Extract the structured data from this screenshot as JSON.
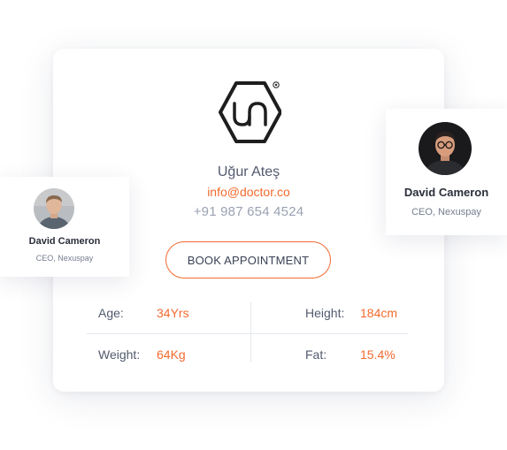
{
  "doctor": {
    "name": "Uğur Ateş",
    "email": "info@doctor.co",
    "phone": "+91 987 654 4524",
    "book_label": "BOOK APPOINTMENT",
    "logo_icon": "ua-hexagon-logo"
  },
  "stats": {
    "age": {
      "label": "Age:",
      "value": "34Yrs"
    },
    "height": {
      "label": "Height:",
      "value": "184cm"
    },
    "weight": {
      "label": "Weight:",
      "value": "64Kg"
    },
    "fat": {
      "label": "Fat:",
      "value": "15.4%"
    }
  },
  "profiles": {
    "left": {
      "name": "David Cameron",
      "role": "CEO, Nexuspay"
    },
    "right": {
      "name": "David Cameron",
      "role": "CEO, Nexuspay"
    }
  },
  "colors": {
    "accent": "#f26a2e",
    "text": "#525a6e",
    "muted": "#9aa1b2"
  }
}
